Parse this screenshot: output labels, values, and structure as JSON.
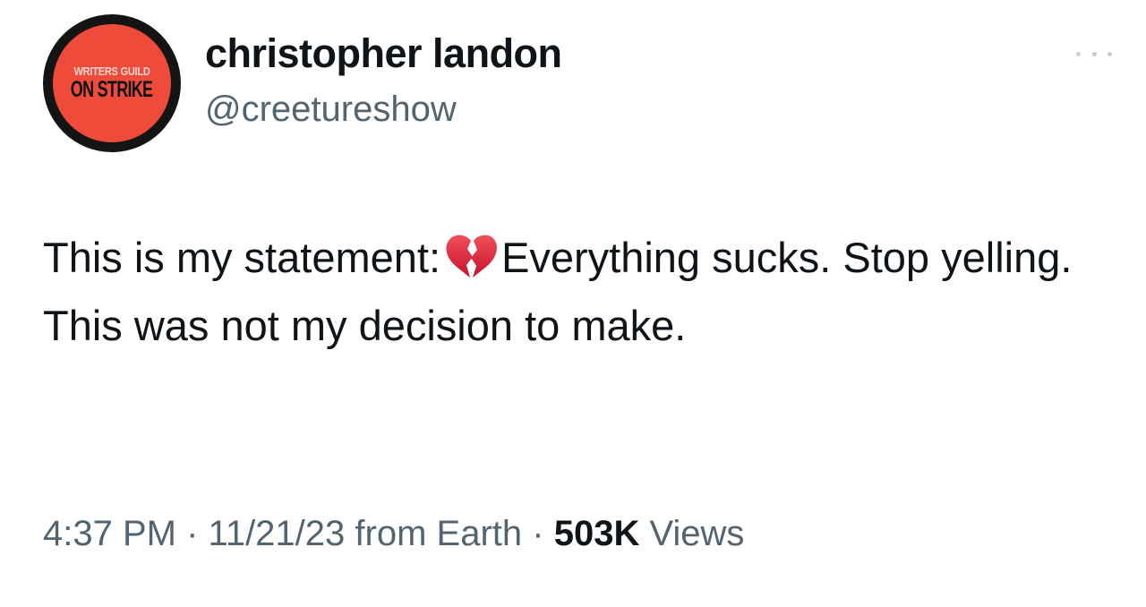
{
  "avatar": {
    "line1": "WRITERS GUILD",
    "line2": "ON STRIKE",
    "ring_color": "#141414",
    "fill_color": "#ef4b3a"
  },
  "author": {
    "display_name": "christopher landon",
    "handle": "@creetureshow"
  },
  "more_menu": {
    "icon": "more-horizontal-icon"
  },
  "tweet": {
    "text_before_emoji": "This is my statement:",
    "emoji": "broken-heart-icon",
    "text_after_emoji": "Everything sucks. Stop yelling. This was not my decision to make."
  },
  "meta": {
    "time": "4:37 PM",
    "separator": "·",
    "date": "11/21/23",
    "source": "from Earth",
    "views_count": "503K",
    "views_label": "Views"
  }
}
